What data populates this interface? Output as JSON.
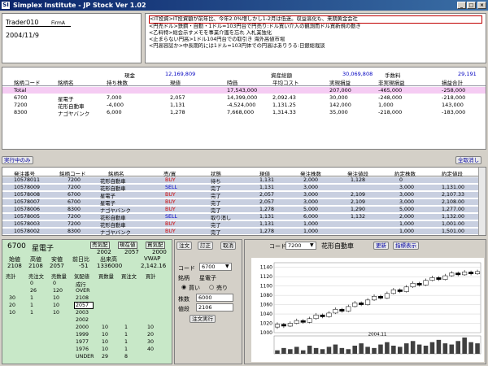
{
  "window": {
    "title": "Simplex Institute - JP Stock Ver 1.02",
    "app_icon": "SI"
  },
  "account": {
    "trader": "Trader010",
    "firm": "FirmA",
    "date": "2004/11/9"
  },
  "news": {
    "items": [
      "<IT投資>IT投資額が前年比、今年2.0%増しかし1-2月は低迷。収益高化も、来期黄金会社",
      "<円売ドル>鉄鋼・自動・1ドル=103円台で円売り:ドル買い介入の観測而ドル買新規の動き",
      "<乙料特>総会示すメモを事業介護を忘れ 入札業独化",
      "<止まらない円高>1ドル104円台での取引き 海外高値市場",
      "<円高容認か>中長期的には1ドル=103円体での円高はありうる:日銀総裁談"
    ]
  },
  "holdings": {
    "summary_labels": {
      "cash": "現金",
      "total_assets": "資産総額",
      "fee": "手数料"
    },
    "summary_values": {
      "cash": "12,169,809",
      "total_assets": "30,069,808",
      "fee": "29,191"
    },
    "headers": [
      "銘柄コード",
      "銘柄名",
      "持ち株数",
      "現値",
      "時価",
      "平均コスト",
      "実現損益",
      "非実現損益",
      "損益合計"
    ],
    "rows": [
      {
        "code": "Total",
        "name": "",
        "qty": "",
        "price": "",
        "value": "17,543,000",
        "cost": "",
        "realized": "207,000",
        "unrealized": "-465,000",
        "total": "-258,000"
      },
      {
        "code": "6700",
        "name": "星電子",
        "qty": "7,000",
        "price": "2,057",
        "value": "14,399,000",
        "cost": "2,092.43",
        "realized": "30,000",
        "unrealized": "-248,000",
        "total": "-218,000"
      },
      {
        "code": "7200",
        "name": "花形自動車",
        "qty": "-4,000",
        "price": "1,131",
        "value": "-4,524,000",
        "cost": "1,131.25",
        "realized": "142,000",
        "unrealized": "1,000",
        "total": "143,000"
      },
      {
        "code": "8300",
        "name": "ナゴヤバンク",
        "qty": "6,000",
        "price": "1,278",
        "value": "7,668,000",
        "cost": "1,314.33",
        "realized": "35,000",
        "unrealized": "-218,000",
        "total": "-183,000"
      }
    ]
  },
  "orders": {
    "in_progress_button": "実行中のみ",
    "cancel_all_button": "全取消し",
    "headers": [
      "発注番号",
      "銘柄コード",
      "銘柄名",
      "売/買",
      "状態",
      "現値",
      "発注株数",
      "発注値段",
      "約定株数",
      "約定値段"
    ],
    "rows": [
      {
        "id": "10578011",
        "code": "7200",
        "name": "花形自動車",
        "side": "BUY",
        "status": "待ち",
        "price": "1,131",
        "qty": "2,000",
        "oprice": "1,128",
        "fqty": "0",
        "fprice": ""
      },
      {
        "id": "10578009",
        "code": "7200",
        "name": "花形自動車",
        "side": "SELL",
        "status": "完了",
        "price": "1,131",
        "qty": "3,000",
        "oprice": "",
        "fqty": "3,000",
        "fprice": "1,131.00"
      },
      {
        "id": "10578008",
        "code": "6700",
        "name": "星電子",
        "side": "BUY",
        "status": "完了",
        "price": "2,057",
        "qty": "3,000",
        "oprice": "2,109",
        "fqty": "3,000",
        "fprice": "2,107.33"
      },
      {
        "id": "10578007",
        "code": "6700",
        "name": "星電子",
        "side": "BUY",
        "status": "完了",
        "price": "2,057",
        "qty": "3,000",
        "oprice": "2,109",
        "fqty": "3,000",
        "fprice": "2,108.00"
      },
      {
        "id": "10578006",
        "code": "8300",
        "name": "ナゴヤバンク",
        "side": "BUY",
        "status": "完了",
        "price": "1,278",
        "qty": "5,000",
        "oprice": "1,290",
        "fqty": "5,000",
        "fprice": "1,277.00"
      },
      {
        "id": "10578005",
        "code": "7200",
        "name": "花形自動車",
        "side": "SELL",
        "status": "取り消し",
        "price": "1,131",
        "qty": "6,000",
        "oprice": "1,132",
        "fqty": "2,000",
        "fprice": "1,132.00"
      },
      {
        "id": "10578003",
        "code": "7200",
        "name": "花形自動車",
        "side": "BUY",
        "status": "完了",
        "price": "1,131",
        "qty": "1,000",
        "oprice": "",
        "fqty": "1,000",
        "fprice": "1,001.00"
      },
      {
        "id": "10578002",
        "code": "8300",
        "name": "ナゴヤバンク",
        "side": "BUY",
        "status": "完了",
        "price": "1,278",
        "qty": "1,000",
        "oprice": "",
        "fqty": "1,000",
        "fprice": "1,501.00"
      }
    ]
  },
  "board": {
    "code": "6700",
    "name": "星電子",
    "labels": {
      "ask": "売気配",
      "last": "現在値",
      "bid": "買気配",
      "open": "始値",
      "high": "高値",
      "low": "安値",
      "prev": "前日比",
      "volume": "出来高",
      "vwap": "VWAP"
    },
    "values": {
      "ask": "2002",
      "last": "2057",
      "bid": "2000",
      "open": "2108",
      "high": "2108",
      "low": "2057",
      "prev": "-51",
      "volume": "1336000",
      "vwap": "2,142.16"
    },
    "quote_headers": [
      "売計",
      "売注文",
      "売数量",
      "気配値",
      "買数量",
      "買注文",
      "買計"
    ],
    "quotes": [
      {
        "a": "",
        "b": "0",
        "c": "0",
        "p": "成行",
        "d": "",
        "e": "",
        "f": ""
      },
      {
        "a": "",
        "b": "26",
        "c": "120",
        "p": "OVER",
        "d": "",
        "e": "",
        "f": ""
      },
      {
        "a": "30",
        "b": "1",
        "c": "10",
        "p": "2108",
        "d": "",
        "e": "",
        "f": ""
      },
      {
        "a": "20",
        "b": "1",
        "c": "10",
        "p": "2057",
        "d": "",
        "e": "",
        "f": ""
      },
      {
        "a": "10",
        "b": "1",
        "c": "10",
        "p": "2003",
        "d": "",
        "e": "",
        "f": ""
      },
      {
        "a": "",
        "b": "",
        "c": "",
        "p": "2002",
        "d": "",
        "e": "",
        "f": ""
      },
      {
        "a": "",
        "b": "",
        "c": "",
        "p": "2000",
        "d": "10",
        "e": "1",
        "f": "10"
      },
      {
        "a": "",
        "b": "",
        "c": "",
        "p": "1999",
        "d": "10",
        "e": "1",
        "f": "20"
      },
      {
        "a": "",
        "b": "",
        "c": "",
        "p": "1977",
        "d": "10",
        "e": "1",
        "f": "30"
      },
      {
        "a": "",
        "b": "",
        "c": "",
        "p": "1976",
        "d": "10",
        "e": "1",
        "f": "40"
      },
      {
        "a": "",
        "b": "",
        "c": "",
        "p": "UNDER",
        "d": "29",
        "e": "8",
        "f": ""
      }
    ]
  },
  "entry": {
    "tabs": [
      "注文",
      "訂正",
      "取消"
    ],
    "code_label": "コード",
    "code_value": "6700",
    "name_label": "銘柄",
    "name_value": "星電子",
    "buy_label": "買い",
    "sell_label": "売り",
    "qty_label": "株数",
    "qty_value": "6000",
    "price_label": "値段",
    "price_value": "2106",
    "execute_button": "注文実行"
  },
  "chart_panel": {
    "code_label": "コード",
    "code_value": "7200",
    "name": "花形自動車",
    "update_button": "更新",
    "indicator_button": "指標表示",
    "month_label": "2004.11"
  },
  "chart_data": {
    "type": "candlestick",
    "ylim": [
      1000,
      1150
    ],
    "yticks": [
      "1140",
      "1120",
      "1100",
      "1080",
      "1060",
      "1040",
      "1020",
      "1000"
    ],
    "xlabel": "2004.11",
    "candles": [
      {
        "o": 1012,
        "c": 1018,
        "h": 1022,
        "l": 1008
      },
      {
        "o": 1018,
        "c": 1014,
        "h": 1021,
        "l": 1010
      },
      {
        "o": 1014,
        "c": 1020,
        "h": 1024,
        "l": 1012
      },
      {
        "o": 1020,
        "c": 1026,
        "h": 1030,
        "l": 1018
      },
      {
        "o": 1026,
        "c": 1022,
        "h": 1029,
        "l": 1019
      },
      {
        "o": 1022,
        "c": 1030,
        "h": 1034,
        "l": 1020
      },
      {
        "o": 1030,
        "c": 1038,
        "h": 1042,
        "l": 1028
      },
      {
        "o": 1038,
        "c": 1034,
        "h": 1041,
        "l": 1031
      },
      {
        "o": 1034,
        "c": 1042,
        "h": 1046,
        "l": 1032
      },
      {
        "o": 1042,
        "c": 1050,
        "h": 1054,
        "l": 1040
      },
      {
        "o": 1050,
        "c": 1046,
        "h": 1053,
        "l": 1043
      },
      {
        "o": 1046,
        "c": 1056,
        "h": 1060,
        "l": 1044
      },
      {
        "o": 1056,
        "c": 1064,
        "h": 1068,
        "l": 1054
      },
      {
        "o": 1064,
        "c": 1060,
        "h": 1067,
        "l": 1057
      },
      {
        "o": 1060,
        "c": 1070,
        "h": 1074,
        "l": 1058
      },
      {
        "o": 1070,
        "c": 1078,
        "h": 1082,
        "l": 1068
      },
      {
        "o": 1078,
        "c": 1074,
        "h": 1081,
        "l": 1071
      },
      {
        "o": 1074,
        "c": 1084,
        "h": 1088,
        "l": 1072
      },
      {
        "o": 1084,
        "c": 1092,
        "h": 1096,
        "l": 1082
      },
      {
        "o": 1092,
        "c": 1088,
        "h": 1095,
        "l": 1085
      },
      {
        "o": 1088,
        "c": 1098,
        "h": 1102,
        "l": 1086
      },
      {
        "o": 1098,
        "c": 1106,
        "h": 1110,
        "l": 1096
      },
      {
        "o": 1106,
        "c": 1102,
        "h": 1109,
        "l": 1099
      },
      {
        "o": 1102,
        "c": 1112,
        "h": 1116,
        "l": 1100
      },
      {
        "o": 1112,
        "c": 1118,
        "h": 1122,
        "l": 1110
      },
      {
        "o": 1118,
        "c": 1114,
        "h": 1121,
        "l": 1111
      },
      {
        "o": 1114,
        "c": 1122,
        "h": 1126,
        "l": 1112
      },
      {
        "o": 1122,
        "c": 1128,
        "h": 1132,
        "l": 1120
      },
      {
        "o": 1128,
        "c": 1124,
        "h": 1131,
        "l": 1121
      },
      {
        "o": 1124,
        "c": 1130,
        "h": 1134,
        "l": 1122
      },
      {
        "o": 1130,
        "c": 1126,
        "h": 1133,
        "l": 1123
      },
      {
        "o": 1126,
        "c": 1131,
        "h": 1135,
        "l": 1124
      }
    ],
    "volume": [
      3,
      5,
      4,
      6,
      3,
      7,
      5,
      4,
      6,
      8,
      5,
      4,
      7,
      9,
      6,
      5,
      8,
      10,
      7,
      6,
      9,
      11,
      8,
      7,
      10,
      12,
      9,
      8,
      11,
      14,
      10,
      9
    ]
  }
}
